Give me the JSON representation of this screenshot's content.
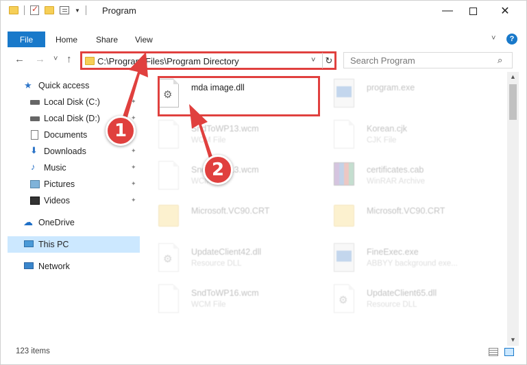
{
  "window": {
    "title": "Program",
    "minimize_glyph": "—",
    "close_glyph": "✕"
  },
  "ribbon": {
    "file": "File",
    "tabs": [
      "Home",
      "Share",
      "View"
    ],
    "help": "?"
  },
  "address": {
    "path": "C:\\Program Files\\Program Directory",
    "refresh_glyph": "↻"
  },
  "search": {
    "placeholder": "Search Program"
  },
  "nav": {
    "back": "←",
    "forward": "→",
    "recent": "˅",
    "up": "↑",
    "items": [
      {
        "label": "Quick access",
        "icon": "star-icon"
      },
      {
        "label": "Local Disk (C:)",
        "icon": "drive-icon",
        "pinned": true
      },
      {
        "label": "Local Disk (D:)",
        "icon": "drive-icon",
        "pinned": true
      },
      {
        "label": "Documents",
        "icon": "document-icon",
        "pinned": true
      },
      {
        "label": "Downloads",
        "icon": "download-icon",
        "pinned": true
      },
      {
        "label": "Music",
        "icon": "music-icon",
        "pinned": true
      },
      {
        "label": "Pictures",
        "icon": "pictures-icon",
        "pinned": true
      },
      {
        "label": "Videos",
        "icon": "videos-icon",
        "pinned": true
      },
      {
        "label": "OneDrive",
        "icon": "cloud-icon"
      },
      {
        "label": "This PC",
        "icon": "computer-icon",
        "selected": true
      },
      {
        "label": "Network",
        "icon": "network-icon"
      }
    ]
  },
  "files": [
    {
      "name": "mda image.dll",
      "type": "",
      "icon": "dll-file-icon",
      "highlighted": true
    },
    {
      "name": "program.exe",
      "type": "",
      "icon": "exe-file-icon"
    },
    {
      "name": "SndToWP13.wcm",
      "type": "WCM File",
      "icon": "generic-file-icon"
    },
    {
      "name": "Korean.cjk",
      "type": "CJK File",
      "icon": "generic-file-icon"
    },
    {
      "name": "SndToWP13.wcm",
      "type": "WCM File",
      "icon": "generic-file-icon"
    },
    {
      "name": "certificates.cab",
      "type": "WinRAR Archive",
      "icon": "archive-file-icon"
    },
    {
      "name": "Microsoft.VC90.CRT",
      "type": "",
      "icon": "folder-icon"
    },
    {
      "name": "Microsoft.VC90.CRT",
      "type": "",
      "icon": "folder-icon"
    },
    {
      "name": "UpdateClient42.dll",
      "type": "Resource DLL",
      "icon": "dll-file-icon"
    },
    {
      "name": "FineExec.exe",
      "type": "ABBYY background exe...",
      "icon": "exe-file-icon"
    },
    {
      "name": "SndToWP16.wcm",
      "type": "WCM File",
      "icon": "generic-file-icon"
    },
    {
      "name": "UpdateClient65.dll",
      "type": "Resource DLL",
      "icon": "dll-file-icon"
    }
  ],
  "status": {
    "item_count": "123 items"
  },
  "annotations": [
    {
      "number": "1",
      "color": "#e0403e"
    },
    {
      "number": "2",
      "color": "#e0403e"
    }
  ]
}
